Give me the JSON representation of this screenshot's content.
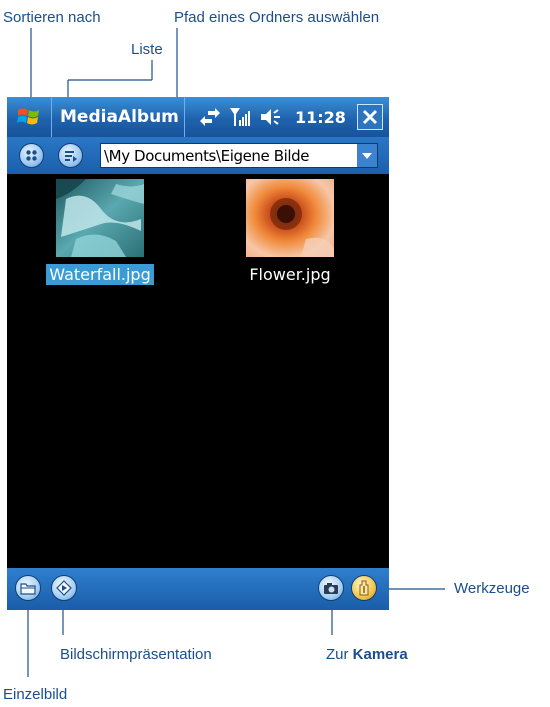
{
  "callouts": {
    "sort_by": "Sortieren nach",
    "choose_folder_path": "Pfad eines Ordners auswählen",
    "list": "Liste",
    "tools": "Werkzeuge",
    "slideshow": "Bildschirmpräsentation",
    "to_camera_prefix": "Zur",
    "to_camera_bold": "Kamera",
    "single_image": "Einzelbild"
  },
  "titlebar": {
    "app_title": "MediaAlbum",
    "clock": "11:28",
    "icons": [
      "windows-start-icon",
      "sync-arrows-icon",
      "signal-strength-icon",
      "speaker-icon",
      "close-icon"
    ]
  },
  "toolbar": {
    "path": "\\My Documents\\Eigene Bilde",
    "icons": [
      "sort-icon",
      "list-view-icon",
      "dropdown-arrow-icon"
    ]
  },
  "thumbnails": [
    {
      "label": "Waterfall.jpg",
      "selected": true
    },
    {
      "label": "Flower.jpg",
      "selected": false
    }
  ],
  "bottombar": {
    "icons": [
      "folder-icon",
      "slideshow-icon",
      "camera-icon",
      "tools-icon"
    ]
  },
  "colors": {
    "callout_text": "#1a4f8c",
    "titlebar": "#1f63ad",
    "selection": "#3a9bd5",
    "screen_background": "#000000"
  }
}
